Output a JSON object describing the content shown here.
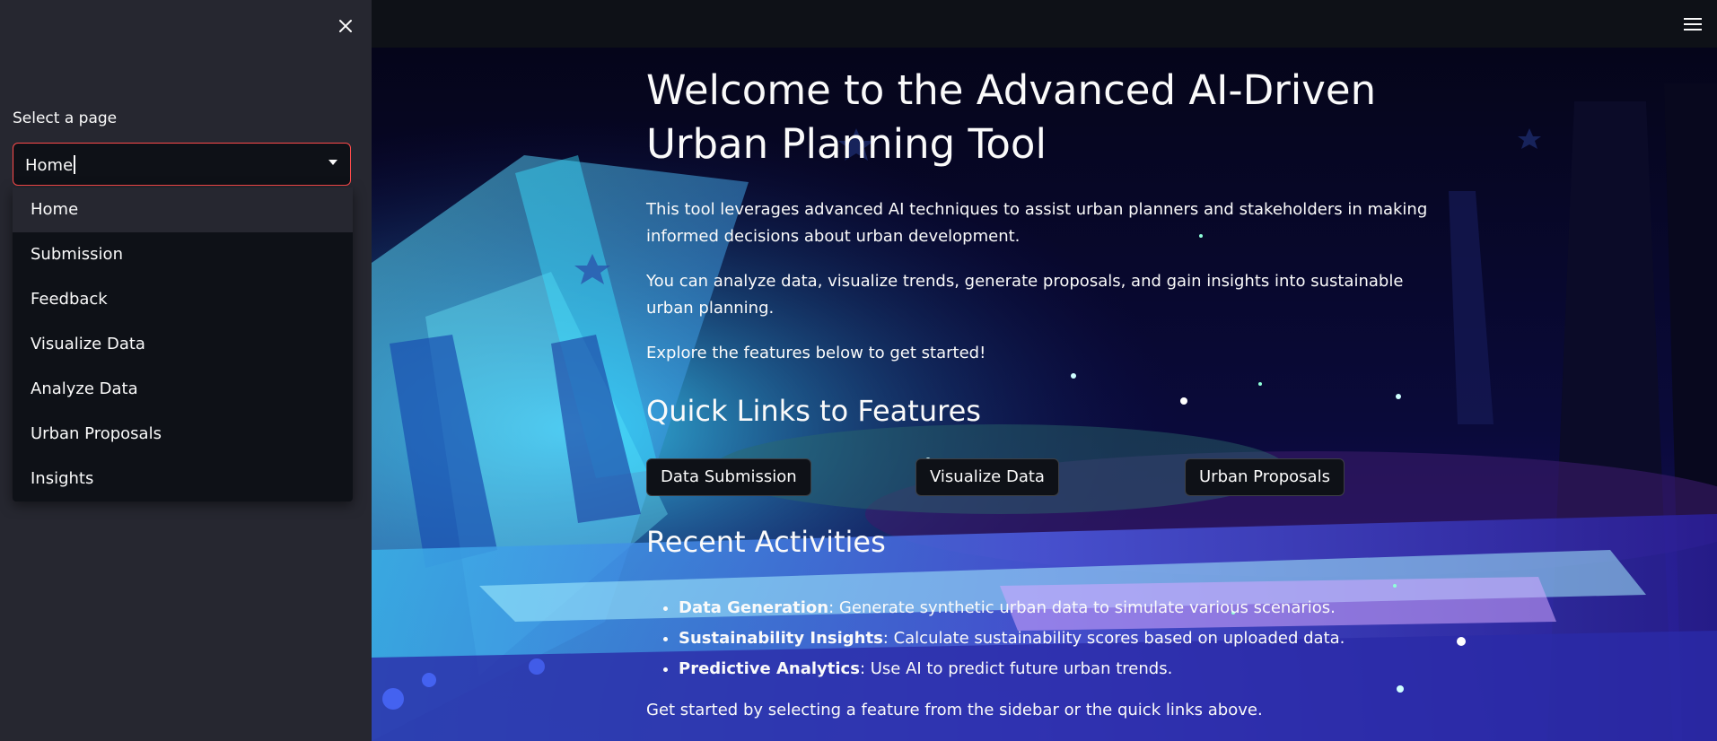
{
  "sidebar": {
    "select_label": "Select a page",
    "selected_value": "Home",
    "options": [
      "Home",
      "Submission",
      "Feedback",
      "Visualize Data",
      "Analyze Data",
      "Urban Proposals",
      "Insights"
    ]
  },
  "main": {
    "title": "Welcome to the Advanced AI-Driven Urban Planning Tool",
    "intro_1": "This tool leverages advanced AI techniques to assist urban planners and stakeholders in making informed decisions about urban development.",
    "intro_2": "You can analyze data, visualize trends, generate proposals, and gain insights into sustainable urban planning.",
    "intro_3": "Explore the features below to get started!",
    "quick_links_heading": "Quick Links to Features",
    "quick_links": [
      "Data Submission",
      "Visualize Data",
      "Urban Proposals"
    ],
    "recent_heading": "Recent Activities",
    "activities": [
      {
        "name": "Data Generation",
        "desc": ": Generate synthetic urban data to simulate various scenarios."
      },
      {
        "name": "Sustainability Insights",
        "desc": ": Calculate sustainability scores based on uploaded data."
      },
      {
        "name": "Predictive Analytics",
        "desc": ": Use AI to predict future urban trends."
      }
    ],
    "footer_text": "Get started by selecting a feature from the sidebar or the quick links above."
  },
  "icons": {
    "close": "close-icon",
    "dropdown": "chevron-down-icon",
    "menu": "hamburger-menu-icon"
  },
  "colors": {
    "accent": "#ff4b4b",
    "sidebar_bg": "#262730",
    "app_bg": "#0e1117"
  }
}
